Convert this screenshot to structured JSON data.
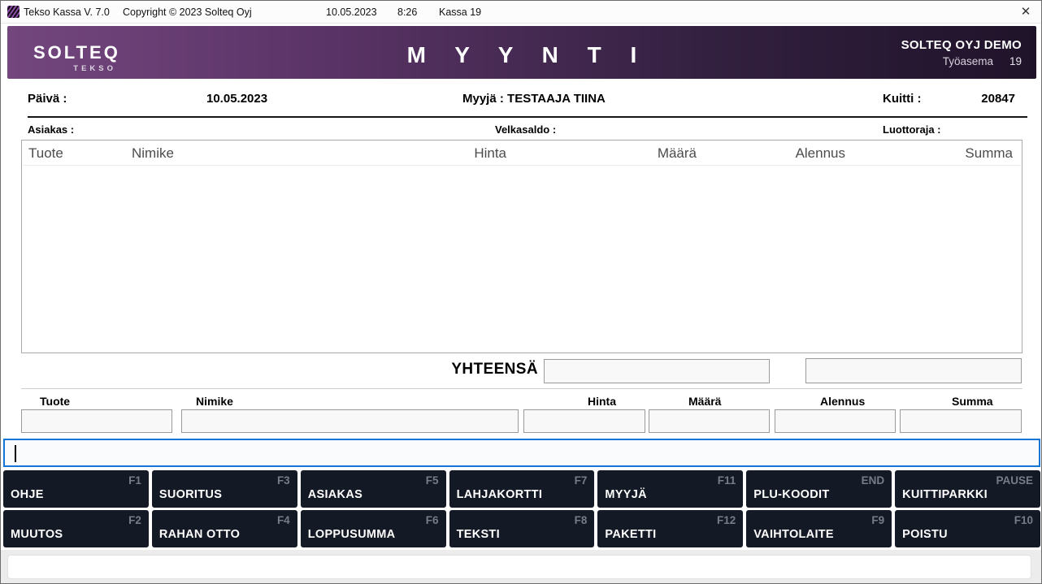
{
  "titlebar": {
    "app_title": "Tekso Kassa V. 7.0",
    "copyright": "Copyright © 2023 Solteq Oyj",
    "date": "10.05.2023",
    "time": "8:26",
    "register": "Kassa 19",
    "close_icon": "✕"
  },
  "header": {
    "logo_primary": "SOLTEQ",
    "logo_secondary": "TEKSO",
    "screen_title": "M Y Y N T I",
    "company": "SOLTEQ OYJ DEMO",
    "workstation_label": "Työasema",
    "workstation_number": "19"
  },
  "sale_info": {
    "date_label": "Päivä :",
    "date_value": "10.05.2023",
    "seller_label": "Myyjä :",
    "seller_value": "TESTAAJA TIINA",
    "receipt_label": "Kuitti :",
    "receipt_number": "20847",
    "customer_label": "Asiakas :",
    "customer_value": "",
    "debt_balance_label": "Velkasaldo :",
    "debt_balance_value": "",
    "credit_limit_label": "Luottoraja :",
    "credit_limit_value": ""
  },
  "items_table": {
    "columns": [
      "Tuote",
      "Nimike",
      "Hinta",
      "Määrä",
      "Alennus",
      "Summa"
    ],
    "rows": []
  },
  "totals": {
    "label": "YHTEENSÄ",
    "total_value": "",
    "secondary_value": ""
  },
  "entry_form": {
    "product_label": "Tuote",
    "product_value": "",
    "name_label": "Nimike",
    "name_value": "",
    "price_label": "Hinta",
    "price_value": "",
    "quantity_label": "Määrä",
    "quantity_value": "",
    "discount_label": "Alennus",
    "discount_value": "",
    "sum_label": "Summa",
    "sum_value": "",
    "command_value": "",
    "status_value": ""
  },
  "function_buttons": {
    "row1": [
      {
        "label": "OHJE",
        "key": "F1"
      },
      {
        "label": "SUORITUS",
        "key": "F3"
      },
      {
        "label": "ASIAKAS",
        "key": "F5"
      },
      {
        "label": "LAHJAKORTTI",
        "key": "F7"
      },
      {
        "label": "MYYJÄ",
        "key": "F11"
      },
      {
        "label": "PLU-KOODIT",
        "key": "END"
      },
      {
        "label": "KUITTIPARKKI",
        "key": "PAUSE"
      }
    ],
    "row2": [
      {
        "label": "MUUTOS",
        "key": "F2"
      },
      {
        "label": "RAHAN OTTO",
        "key": "F4"
      },
      {
        "label": "LOPPUSUMMA",
        "key": "F6"
      },
      {
        "label": "TEKSTI",
        "key": "F8"
      },
      {
        "label": "PAKETTI",
        "key": "F12"
      },
      {
        "label": "VAIHTOLAITE",
        "key": "F9"
      },
      {
        "label": "POISTU",
        "key": "F10"
      }
    ]
  },
  "colors": {
    "accent-blue": "#1376d6",
    "header-gradient-left": "#73477e",
    "header-gradient-right": "#1f1329",
    "button-bg": "#141926",
    "button-key-text": "#767c89",
    "titlebar-bg": "#fcfcfc",
    "bottom-strip-bg": "#ececec"
  }
}
